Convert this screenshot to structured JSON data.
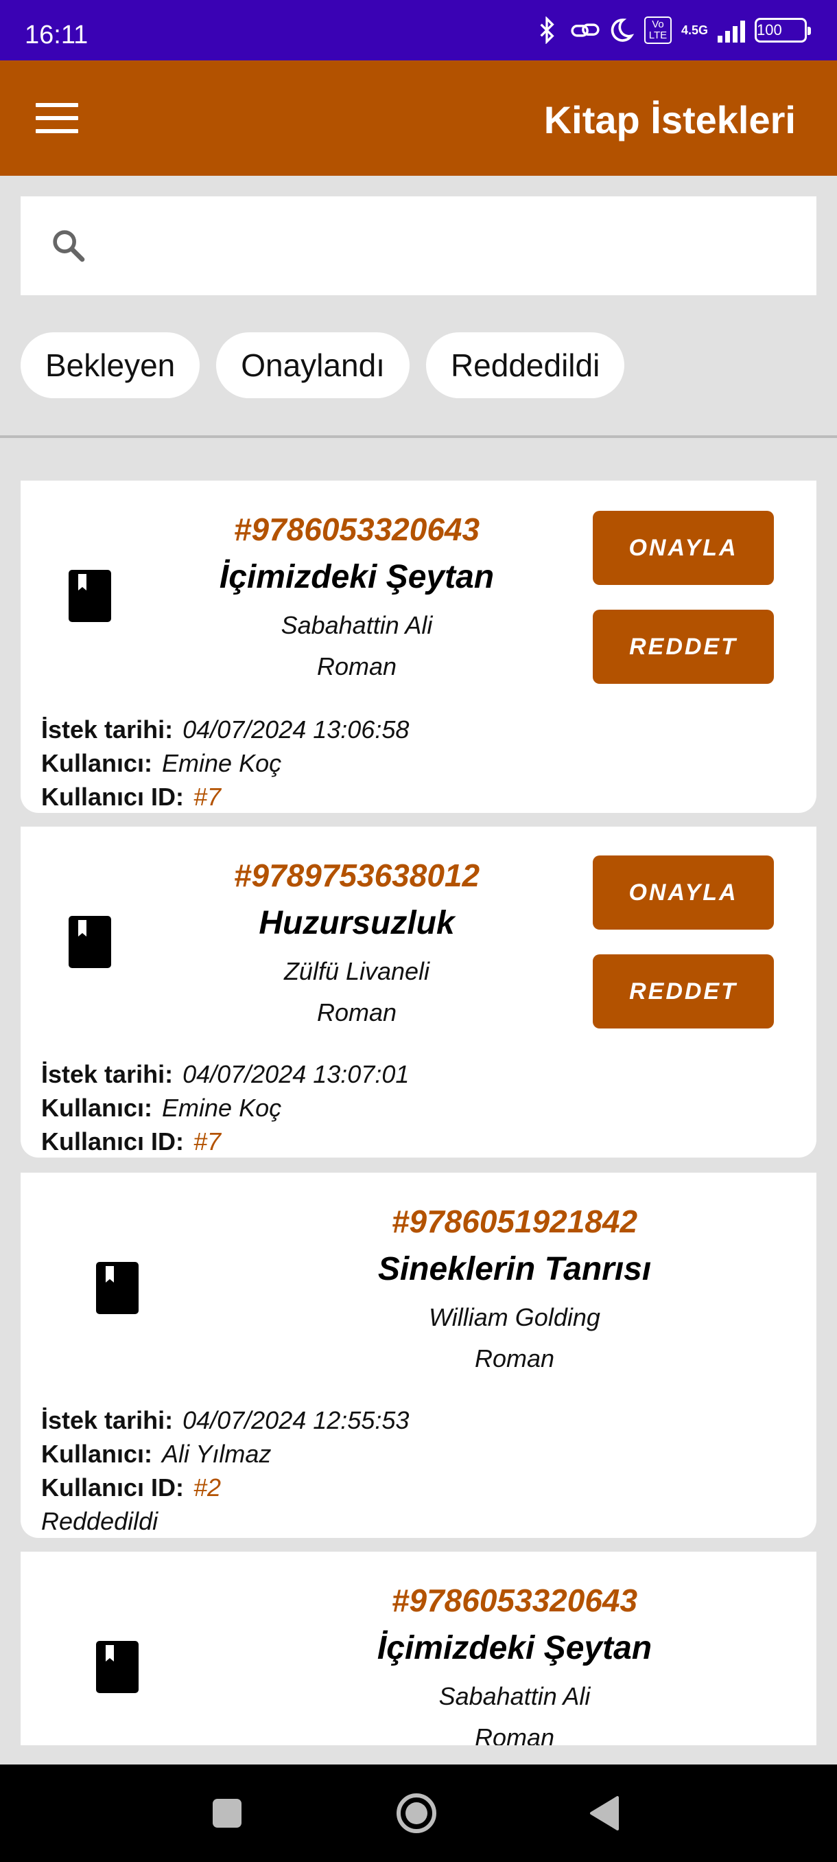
{
  "status_bar": {
    "time": "16:11",
    "volte": "Vo LTE",
    "network": "4.5G",
    "battery": "100"
  },
  "app_bar": {
    "title": "Kitap İstekleri",
    "menu_icon": "hamburger-menu-icon"
  },
  "search": {
    "placeholder": "",
    "value": "",
    "icon": "search-icon"
  },
  "filters": [
    {
      "label": "Bekleyen"
    },
    {
      "label": "Onaylandı"
    },
    {
      "label": "Reddedildi"
    }
  ],
  "labels": {
    "request_date": "İstek tarihi:",
    "user": "Kullanıcı:",
    "user_id": "Kullanıcı ID:",
    "approve": "ONAYLA",
    "reject": "REDDET"
  },
  "requests": [
    {
      "isbn": "#9786053320643",
      "title": "İçimizdeki Şeytan",
      "author": "Sabahattin Ali",
      "genre": "Roman",
      "date": "04/07/2024 13:06:58",
      "user": "Emine Koç",
      "user_id": "#7"
    },
    {
      "isbn": "#9789753638012",
      "title": "Huzursuzluk",
      "author": "Zülfü Livaneli",
      "genre": "Roman",
      "date": "04/07/2024 13:07:01",
      "user": "Emine Koç",
      "user_id": "#7"
    },
    {
      "isbn": "#9786051921842",
      "title": "Sineklerin Tanrısı",
      "author": "William Golding",
      "genre": "Roman",
      "date": "04/07/2024 12:55:53",
      "user": "Ali Yılmaz",
      "user_id": "#2",
      "status": "Reddedildi"
    },
    {
      "isbn": "#9786053320643",
      "title": "İçimizdeki Şeytan",
      "author": "Sabahattin Ali",
      "genre": "Roman"
    }
  ],
  "colors": {
    "status_bar": "#3a02b4",
    "primary": "#b35200",
    "background": "#e1e1e1",
    "card": "#ffffff"
  }
}
